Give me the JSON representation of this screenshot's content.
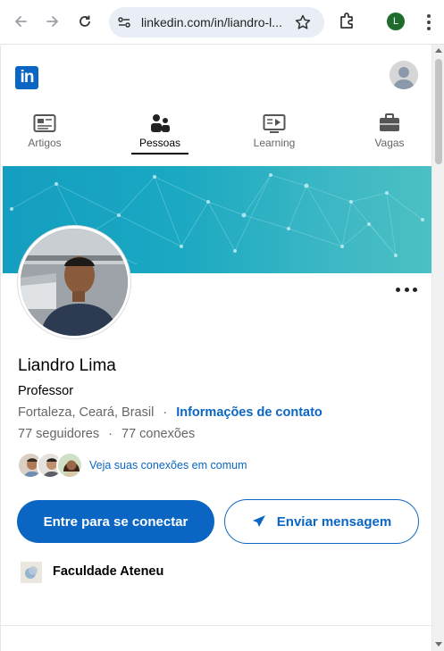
{
  "browser": {
    "url": "linkedin.com/in/liandro-l...",
    "profile_initial": "L",
    "profile_color": "#1e6b2c"
  },
  "header": {
    "logo_text": "in",
    "brand_color": "#0a66c2"
  },
  "tabs": [
    {
      "label": "Artigos",
      "icon": "article-icon",
      "active": false
    },
    {
      "label": "Pessoas",
      "icon": "people-icon",
      "active": true
    },
    {
      "label": "Learning",
      "icon": "learning-icon",
      "active": false
    },
    {
      "label": "Vagas",
      "icon": "briefcase-icon",
      "active": false
    }
  ],
  "profile": {
    "name": "Liandro Lima",
    "headline": "Professor",
    "location": "Fortaleza, Ceará, Brasil",
    "separator": "·",
    "contact_link": "Informações de contato",
    "followers": "77 seguidores",
    "connections": "77 conexões",
    "mutual_text": "Veja suas conexões em comum"
  },
  "actions": {
    "connect_label": "Entre para se conectar",
    "message_label": "Enviar mensagem"
  },
  "education": {
    "name": "Faculdade Ateneu"
  }
}
